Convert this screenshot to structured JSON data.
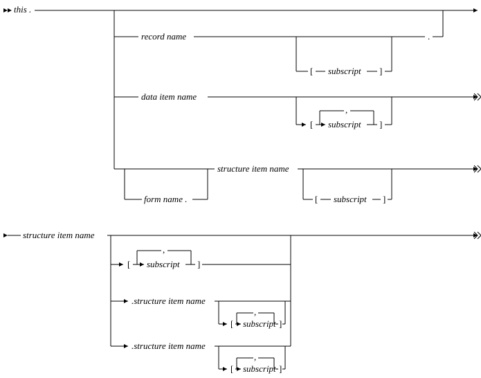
{
  "diagram": {
    "kind": "railroad-syntax-diagram",
    "start_label": "this .",
    "branches": [
      {
        "id": "record",
        "label": "record name",
        "subscript": {
          "optional": true,
          "repeatable": false,
          "label": "subscript",
          "open": "[",
          "close": "]"
        },
        "trailer": "."
      },
      {
        "id": "data-item",
        "label": "data item name",
        "subscript": {
          "optional": true,
          "repeatable": true,
          "repeat_separator": ",",
          "label": "subscript",
          "open": "[",
          "close": "]"
        }
      },
      {
        "id": "structure-item",
        "label": "structure item name",
        "qualifier": {
          "optional": true,
          "label": "form name ."
        },
        "subscript": {
          "optional": true,
          "repeatable": false,
          "label": "subscript",
          "open": "[",
          "close": "]"
        }
      }
    ],
    "continuation": {
      "label": "structure item name",
      "subscript": {
        "optional": true,
        "repeatable": true,
        "repeat_separator": ",",
        "label": "subscript",
        "open": "[",
        "close": "]"
      },
      "nested": [
        {
          "label": ".structure item name",
          "optional": true,
          "subscript": {
            "optional": true,
            "repeatable": true,
            "repeat_separator": ",",
            "label": "subscript",
            "open": "[",
            "close": "]"
          }
        },
        {
          "label": ".structure item name",
          "optional": true,
          "subscript": {
            "optional": true,
            "repeatable": true,
            "repeat_separator": ",",
            "label": "subscript",
            "open": "[",
            "close": "]"
          }
        }
      ]
    }
  },
  "t": {
    "this": "this .",
    "record_name": "record name",
    "data_item_name": "data item name",
    "structure_item_name": "structure item name",
    "form_name": "form name .",
    "subscript": "subscript",
    "dot_structure_item_name": ".structure item name",
    "lbr": "[",
    "rbr": "]",
    "comma": ",",
    "dot": "."
  }
}
